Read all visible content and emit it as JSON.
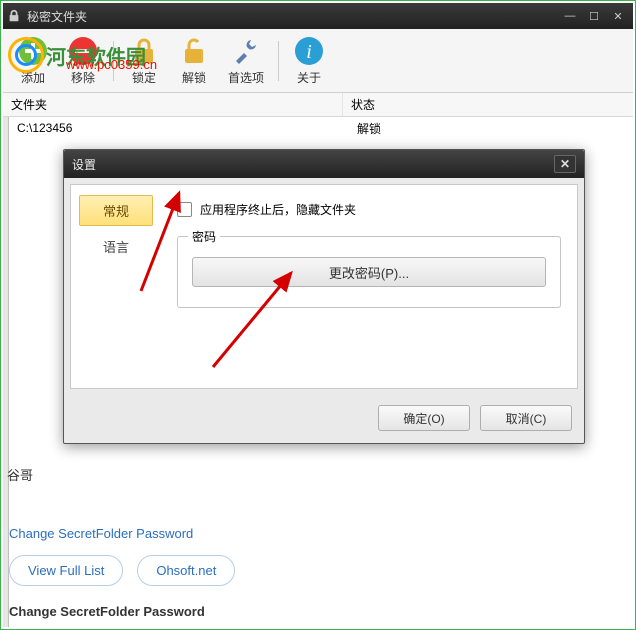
{
  "window": {
    "title": "秘密文件夹"
  },
  "watermark": {
    "text": "河东软件园",
    "url": "www.pc0359.cn"
  },
  "toolbar": {
    "add": "添加",
    "remove": "移除",
    "lock": "锁定",
    "unlock": "解锁",
    "prefs": "首选项",
    "about": "关于"
  },
  "columns": {
    "folder": "文件夹",
    "status": "状态"
  },
  "rows": [
    {
      "path": "C:\\123456",
      "status": "解锁"
    }
  ],
  "dialog": {
    "title": "设置",
    "tabs": {
      "general": "常规",
      "language": "语言"
    },
    "hide_after_exit": "应用程序终止后，隐藏文件夹",
    "password_group": "密码",
    "change_password": "更改密码(P)...",
    "ok": "确定(O)",
    "cancel": "取消(C)"
  },
  "footer": {
    "truncated": "谷哥",
    "link": "Change SecretFolder Password",
    "view_full": "View Full List",
    "ohsoft": "Ohsoft.net",
    "bold": "Change SecretFolder Password"
  }
}
